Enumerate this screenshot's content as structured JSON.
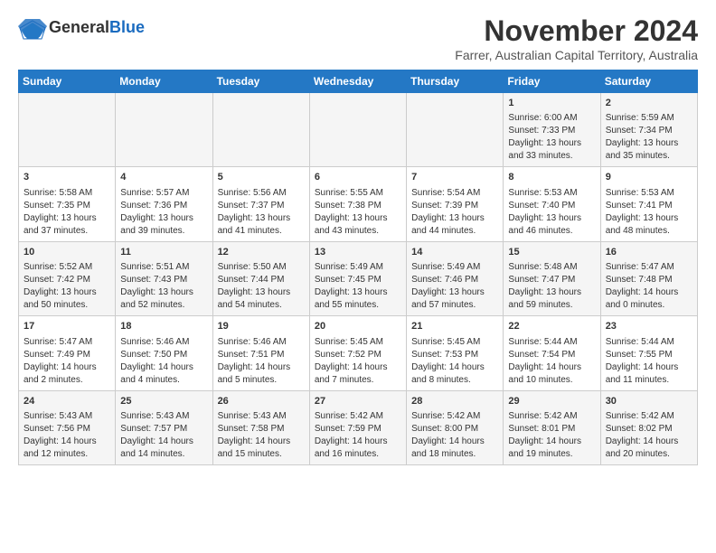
{
  "header": {
    "logo_general": "General",
    "logo_blue": "Blue",
    "month_title": "November 2024",
    "subtitle": "Farrer, Australian Capital Territory, Australia"
  },
  "days_of_week": [
    "Sunday",
    "Monday",
    "Tuesday",
    "Wednesday",
    "Thursday",
    "Friday",
    "Saturday"
  ],
  "weeks": [
    [
      {
        "day": "",
        "content": ""
      },
      {
        "day": "",
        "content": ""
      },
      {
        "day": "",
        "content": ""
      },
      {
        "day": "",
        "content": ""
      },
      {
        "day": "",
        "content": ""
      },
      {
        "day": "1",
        "content": "Sunrise: 6:00 AM\nSunset: 7:33 PM\nDaylight: 13 hours\nand 33 minutes."
      },
      {
        "day": "2",
        "content": "Sunrise: 5:59 AM\nSunset: 7:34 PM\nDaylight: 13 hours\nand 35 minutes."
      }
    ],
    [
      {
        "day": "3",
        "content": "Sunrise: 5:58 AM\nSunset: 7:35 PM\nDaylight: 13 hours\nand 37 minutes."
      },
      {
        "day": "4",
        "content": "Sunrise: 5:57 AM\nSunset: 7:36 PM\nDaylight: 13 hours\nand 39 minutes."
      },
      {
        "day": "5",
        "content": "Sunrise: 5:56 AM\nSunset: 7:37 PM\nDaylight: 13 hours\nand 41 minutes."
      },
      {
        "day": "6",
        "content": "Sunrise: 5:55 AM\nSunset: 7:38 PM\nDaylight: 13 hours\nand 43 minutes."
      },
      {
        "day": "7",
        "content": "Sunrise: 5:54 AM\nSunset: 7:39 PM\nDaylight: 13 hours\nand 44 minutes."
      },
      {
        "day": "8",
        "content": "Sunrise: 5:53 AM\nSunset: 7:40 PM\nDaylight: 13 hours\nand 46 minutes."
      },
      {
        "day": "9",
        "content": "Sunrise: 5:53 AM\nSunset: 7:41 PM\nDaylight: 13 hours\nand 48 minutes."
      }
    ],
    [
      {
        "day": "10",
        "content": "Sunrise: 5:52 AM\nSunset: 7:42 PM\nDaylight: 13 hours\nand 50 minutes."
      },
      {
        "day": "11",
        "content": "Sunrise: 5:51 AM\nSunset: 7:43 PM\nDaylight: 13 hours\nand 52 minutes."
      },
      {
        "day": "12",
        "content": "Sunrise: 5:50 AM\nSunset: 7:44 PM\nDaylight: 13 hours\nand 54 minutes."
      },
      {
        "day": "13",
        "content": "Sunrise: 5:49 AM\nSunset: 7:45 PM\nDaylight: 13 hours\nand 55 minutes."
      },
      {
        "day": "14",
        "content": "Sunrise: 5:49 AM\nSunset: 7:46 PM\nDaylight: 13 hours\nand 57 minutes."
      },
      {
        "day": "15",
        "content": "Sunrise: 5:48 AM\nSunset: 7:47 PM\nDaylight: 13 hours\nand 59 minutes."
      },
      {
        "day": "16",
        "content": "Sunrise: 5:47 AM\nSunset: 7:48 PM\nDaylight: 14 hours\nand 0 minutes."
      }
    ],
    [
      {
        "day": "17",
        "content": "Sunrise: 5:47 AM\nSunset: 7:49 PM\nDaylight: 14 hours\nand 2 minutes."
      },
      {
        "day": "18",
        "content": "Sunrise: 5:46 AM\nSunset: 7:50 PM\nDaylight: 14 hours\nand 4 minutes."
      },
      {
        "day": "19",
        "content": "Sunrise: 5:46 AM\nSunset: 7:51 PM\nDaylight: 14 hours\nand 5 minutes."
      },
      {
        "day": "20",
        "content": "Sunrise: 5:45 AM\nSunset: 7:52 PM\nDaylight: 14 hours\nand 7 minutes."
      },
      {
        "day": "21",
        "content": "Sunrise: 5:45 AM\nSunset: 7:53 PM\nDaylight: 14 hours\nand 8 minutes."
      },
      {
        "day": "22",
        "content": "Sunrise: 5:44 AM\nSunset: 7:54 PM\nDaylight: 14 hours\nand 10 minutes."
      },
      {
        "day": "23",
        "content": "Sunrise: 5:44 AM\nSunset: 7:55 PM\nDaylight: 14 hours\nand 11 minutes."
      }
    ],
    [
      {
        "day": "24",
        "content": "Sunrise: 5:43 AM\nSunset: 7:56 PM\nDaylight: 14 hours\nand 12 minutes."
      },
      {
        "day": "25",
        "content": "Sunrise: 5:43 AM\nSunset: 7:57 PM\nDaylight: 14 hours\nand 14 minutes."
      },
      {
        "day": "26",
        "content": "Sunrise: 5:43 AM\nSunset: 7:58 PM\nDaylight: 14 hours\nand 15 minutes."
      },
      {
        "day": "27",
        "content": "Sunrise: 5:42 AM\nSunset: 7:59 PM\nDaylight: 14 hours\nand 16 minutes."
      },
      {
        "day": "28",
        "content": "Sunrise: 5:42 AM\nSunset: 8:00 PM\nDaylight: 14 hours\nand 18 minutes."
      },
      {
        "day": "29",
        "content": "Sunrise: 5:42 AM\nSunset: 8:01 PM\nDaylight: 14 hours\nand 19 minutes."
      },
      {
        "day": "30",
        "content": "Sunrise: 5:42 AM\nSunset: 8:02 PM\nDaylight: 14 hours\nand 20 minutes."
      }
    ]
  ]
}
